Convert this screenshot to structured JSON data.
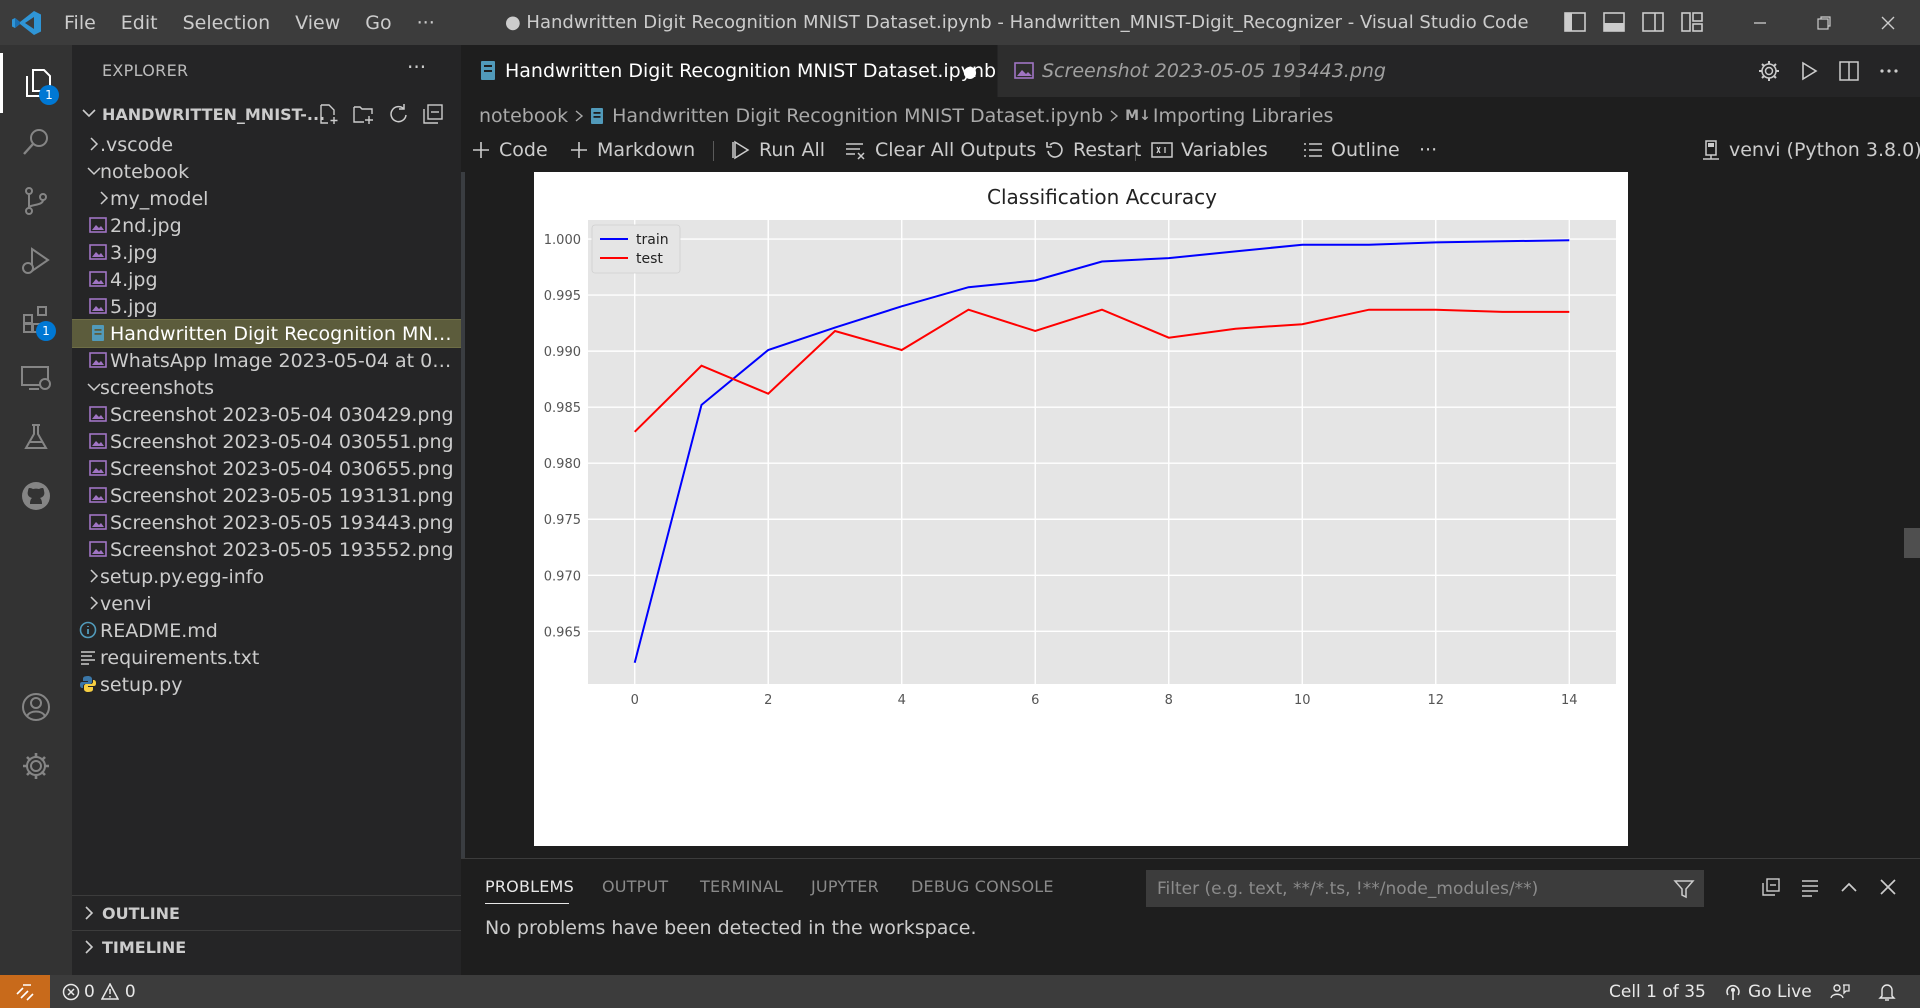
{
  "titlebar": {
    "menu": [
      "File",
      "Edit",
      "Selection",
      "View",
      "Go",
      "···"
    ],
    "title": "● Handwritten Digit Recognition MNIST Dataset.ipynb - Handwritten_MNIST-Digit_Recognizer - Visual Studio Code"
  },
  "activity": {
    "explorer_badge": "1",
    "extensions_badge": "1"
  },
  "sidebar": {
    "header": "EXPLORER",
    "more": "···",
    "root": "HANDWRITTEN_MNIST-...",
    "tree": [
      {
        "label": ".vscode",
        "type": "folder-closed",
        "depth": 1
      },
      {
        "label": "notebook",
        "type": "folder-open",
        "depth": 1
      },
      {
        "label": "my_model",
        "type": "folder-closed",
        "depth": 2
      },
      {
        "label": "2nd.jpg",
        "type": "image",
        "depth": 2
      },
      {
        "label": "3.jpg",
        "type": "image",
        "depth": 2
      },
      {
        "label": "4.jpg",
        "type": "image",
        "depth": 2
      },
      {
        "label": "5.jpg",
        "type": "image",
        "depth": 2
      },
      {
        "label": "Handwritten Digit Recognition MNI...",
        "type": "notebook",
        "depth": 2,
        "selected": true
      },
      {
        "label": "WhatsApp Image 2023-05-04 at 02....",
        "type": "image",
        "depth": 2
      },
      {
        "label": "screenshots",
        "type": "folder-open",
        "depth": 1
      },
      {
        "label": "Screenshot 2023-05-04 030429.png",
        "type": "image",
        "depth": 2
      },
      {
        "label": "Screenshot 2023-05-04 030551.png",
        "type": "image",
        "depth": 2
      },
      {
        "label": "Screenshot 2023-05-04 030655.png",
        "type": "image",
        "depth": 2
      },
      {
        "label": "Screenshot 2023-05-05 193131.png",
        "type": "image",
        "depth": 2
      },
      {
        "label": "Screenshot 2023-05-05 193443.png",
        "type": "image",
        "depth": 2
      },
      {
        "label": "Screenshot 2023-05-05 193552.png",
        "type": "image",
        "depth": 2
      },
      {
        "label": "setup.py.egg-info",
        "type": "folder-closed",
        "depth": 1
      },
      {
        "label": "venvi",
        "type": "folder-closed",
        "depth": 1
      },
      {
        "label": "README.md",
        "type": "info",
        "depth": 1
      },
      {
        "label": "requirements.txt",
        "type": "text",
        "depth": 1
      },
      {
        "label": "setup.py",
        "type": "python",
        "depth": 1
      }
    ],
    "outline": "OUTLINE",
    "timeline": "TIMELINE"
  },
  "editor": {
    "tabs": [
      {
        "label": "Handwritten Digit Recognition MNIST Dataset.ipynb",
        "dirty": "●",
        "active": true
      },
      {
        "label": "Screenshot 2023-05-05 193443.png",
        "active": false
      }
    ],
    "breadcrumb": {
      "folder": "notebook",
      "file": "Handwritten Digit Recognition MNIST Dataset.ipynb",
      "md_badge": "M↓",
      "section": "Importing Libraries"
    },
    "toolbar": {
      "code": "Code",
      "markdown": "Markdown",
      "run_all": "Run All",
      "clear_outputs": "Clear All Outputs",
      "restart": "Restart",
      "variables": "Variables",
      "outline": "Outline",
      "more": "···",
      "kernel": "venvi (Python 3.8.0)"
    }
  },
  "chart_data": {
    "type": "line",
    "title": "Classification Accuracy",
    "xlabel": "",
    "ylabel": "",
    "x": [
      0,
      1,
      2,
      3,
      4,
      5,
      6,
      7,
      8,
      9,
      10,
      11,
      12,
      13,
      14
    ],
    "series": [
      {
        "name": "train",
        "color": "#0000ff",
        "values": [
          0.9622,
          0.9852,
          0.9901,
          0.9921,
          0.994,
          0.9957,
          0.9963,
          0.998,
          0.9983,
          0.9989,
          0.9995,
          0.9995,
          0.9997,
          0.9998,
          0.9999
        ]
      },
      {
        "name": "test",
        "color": "#ff0000",
        "values": [
          0.9828,
          0.9887,
          0.9862,
          0.9918,
          0.9901,
          0.9937,
          0.9918,
          0.9937,
          0.9912,
          0.992,
          0.9924,
          0.9937,
          0.9937,
          0.9935,
          0.9935
        ]
      }
    ],
    "xticks": [
      0,
      2,
      4,
      6,
      8,
      10,
      12,
      14
    ],
    "yticks": [
      "0.965",
      "0.970",
      "0.975",
      "0.980",
      "0.985",
      "0.990",
      "0.995",
      "1.000"
    ],
    "xlim": [
      -0.7,
      14.7
    ],
    "ylim": [
      0.9603,
      1.0017
    ],
    "grid": true,
    "legend": "upper-left",
    "background": "#e5e5e5"
  },
  "panel": {
    "tabs": [
      "PROBLEMS",
      "OUTPUT",
      "TERMINAL",
      "JUPYTER",
      "DEBUG CONSOLE"
    ],
    "filter_placeholder": "Filter (e.g. text, **/*.ts, !**/node_modules/**)",
    "message": "No problems have been detected in the workspace."
  },
  "status": {
    "errors": "0",
    "warnings": "0",
    "cell": "Cell 1 of 35",
    "golive": "Go Live"
  },
  "colors": {
    "accent": "#0078d4",
    "remote": "#c86a1b",
    "selected_row": "#5c5c3c"
  }
}
